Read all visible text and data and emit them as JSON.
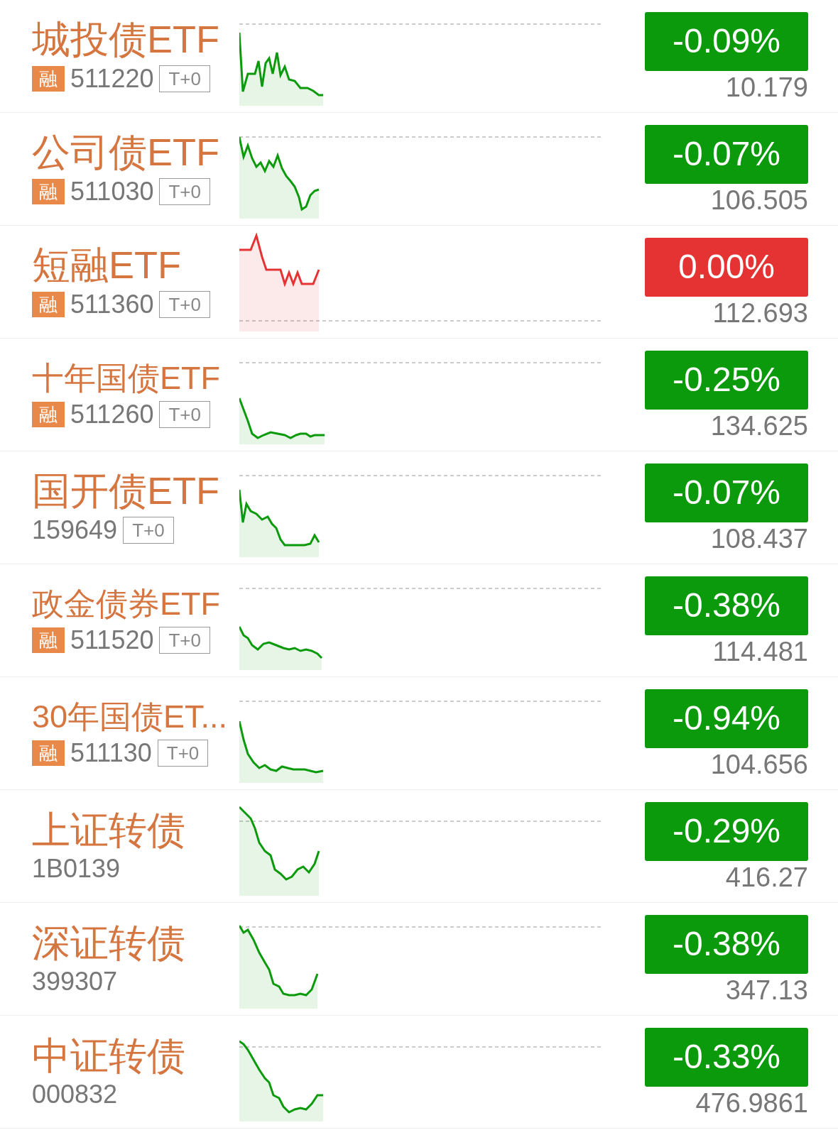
{
  "rows": [
    {
      "name": "城投债ETF",
      "badge": "融",
      "code": "511220",
      "tag": "T+0",
      "change": "-0.09%",
      "price": "10.179",
      "color": "#0b9a0b"
    },
    {
      "name": "公司债ETF",
      "badge": "融",
      "code": "511030",
      "tag": "T+0",
      "change": "-0.07%",
      "price": "106.505",
      "color": "#0b9a0b"
    },
    {
      "name": "短融ETF",
      "badge": "融",
      "code": "511360",
      "tag": "T+0",
      "change": "0.00%",
      "price": "112.693",
      "color": "#e53333"
    },
    {
      "name": "十年国债ETF",
      "badge": "融",
      "code": "511260",
      "tag": "T+0",
      "change": "-0.25%",
      "price": "134.625",
      "color": "#0b9a0b"
    },
    {
      "name": "国开债ETF",
      "code": "159649",
      "tag": "T+0",
      "change": "-0.07%",
      "price": "108.437",
      "color": "#0b9a0b"
    },
    {
      "name": "政金债券ETF",
      "badge": "融",
      "code": "511520",
      "tag": "T+0",
      "change": "-0.38%",
      "price": "114.481",
      "color": "#0b9a0b"
    },
    {
      "name": "30年国债ET...",
      "badge": "融",
      "code": "511130",
      "tag": "T+0",
      "change": "-0.94%",
      "price": "104.656",
      "color": "#0b9a0b"
    },
    {
      "name": "上证转债",
      "code": "1B0139",
      "change": "-0.29%",
      "price": "416.27",
      "color": "#0b9a0b"
    },
    {
      "name": "深证转债",
      "code": "399307",
      "change": "-0.38%",
      "price": "347.13",
      "color": "#0b9a0b"
    },
    {
      "name": "中证转债",
      "code": "000832",
      "change": "-0.33%",
      "price": "476.9861",
      "color": "#0b9a0b"
    }
  ]
}
